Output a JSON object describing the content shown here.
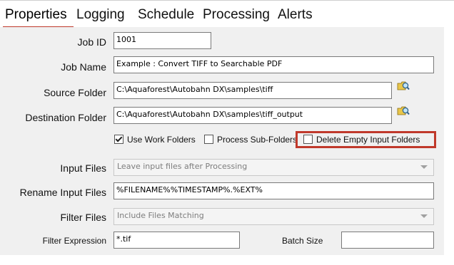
{
  "tabs": [
    {
      "label": "Properties",
      "active": true
    },
    {
      "label": "Logging"
    },
    {
      "label": "Schedule"
    },
    {
      "label": "Processing"
    },
    {
      "label": "Alerts"
    }
  ],
  "form": {
    "job_id": {
      "label": "Job ID",
      "value": "1001"
    },
    "job_name": {
      "label": "Job Name",
      "value": "Example : Convert TIFF to Searchable PDF"
    },
    "source_folder": {
      "label": "Source Folder",
      "value": "C:\\Aquaforest\\Autobahn DX\\samples\\tiff"
    },
    "destination_folder": {
      "label": "Destination Folder",
      "value": "C:\\Aquaforest\\Autobahn DX\\samples\\tiff_output"
    },
    "checkboxes": {
      "use_work_folders": {
        "label": "Use Work Folders",
        "checked": true
      },
      "process_sub_folders": {
        "label": "Process Sub-Folders",
        "checked": false
      },
      "delete_empty_input_folders": {
        "label": "Delete Empty Input Folders",
        "checked": false
      }
    },
    "input_files": {
      "label": "Input Files",
      "value": "Leave input files after Processing"
    },
    "rename_input_files": {
      "label": "Rename Input Files",
      "value": "%FILENAME%%TIMESTAMP%.%EXT%"
    },
    "filter_files": {
      "label": "Filter Files",
      "value": "Include Files Matching"
    },
    "filter_expression": {
      "label": "Filter Expression",
      "value": "*.tif"
    },
    "batch_size": {
      "label": "Batch Size",
      "value": ""
    }
  },
  "colors": {
    "highlight": "#c0392b",
    "panel_bg": "#f0f0f0"
  },
  "icons": {
    "browse": "folder-magnifier-icon"
  }
}
